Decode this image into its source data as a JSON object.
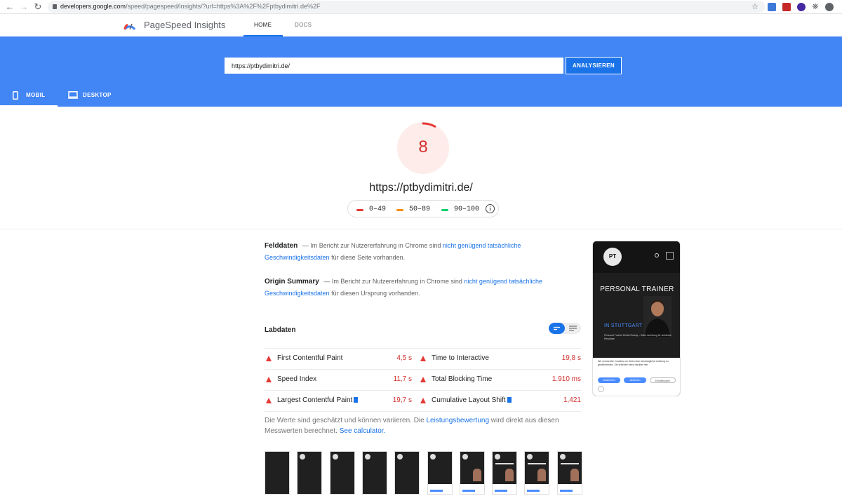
{
  "browser": {
    "url_host": "developers.google.com",
    "url_path": "/speed/pagespeed/insights/?url=https%3A%2F%2Fptbydimitri.de%2F"
  },
  "header": {
    "brand": "PageSpeed Insights",
    "nav": {
      "home": "HOME",
      "docs": "DOCS"
    }
  },
  "search": {
    "value": "https://ptbydimitri.de/",
    "button": "ANALYSIEREN"
  },
  "device_tabs": {
    "mobile": "MOBIL",
    "desktop": "DESKTOP"
  },
  "score": {
    "value": "8",
    "fraction": 0.08,
    "color": "#e53935",
    "url": "https://ptbydimitri.de/",
    "legend": [
      {
        "range": "0–49",
        "color": "#e53935"
      },
      {
        "range": "50–89",
        "color": "#fb8c00"
      },
      {
        "range": "90–100",
        "color": "#0cce6b"
      }
    ]
  },
  "field_data": {
    "title": "Felddaten",
    "text_before": "— Im Bericht zur Nutzererfahrung in Chrome sind",
    "link": "nicht genügend tatsächliche Geschwindigkeitsdaten",
    "text_after": "für diese Seite vorhanden."
  },
  "origin_summary": {
    "title": "Origin Summary",
    "text_before": "— Im Bericht zur Nutzererfahrung in Chrome sind",
    "link": "nicht genügend tatsächliche Geschwindigkeitsdaten",
    "text_after": "für diesen Ursprung vorhanden."
  },
  "lab": {
    "title": "Labdaten",
    "metrics": [
      {
        "name": "First Contentful Paint",
        "value": "4,5 s",
        "flag": false
      },
      {
        "name": "Time to Interactive",
        "value": "19,8 s",
        "flag": false
      },
      {
        "name": "Speed Index",
        "value": "11,7 s",
        "flag": false
      },
      {
        "name": "Total Blocking Time",
        "value": "1.910 ms",
        "flag": false
      },
      {
        "name": "Largest Contentful Paint",
        "value": "19,7 s",
        "flag": true
      },
      {
        "name": "Cumulative Layout Shift",
        "value": "1,421",
        "flag": true
      }
    ],
    "note_before": "Die Werte sind geschätzt und können variieren. Die",
    "note_link": "Leistungsbewertung",
    "note_after": "wird direkt aus diesen Messwerten berechnet.",
    "note_calc": "See calculator."
  },
  "preview": {
    "logo": "PT",
    "headline": "PERSONAL TRAINER",
    "subheadline": "IN STUTTGART",
    "tagline": "Personal Trainer Dimitri Rutsky – Klare Anleitung für sichtbare Resultate",
    "cookie_text": "Wir verwenden Cookies um Ihnen eine bestmögliche Leistung zu gewährleisten. Sie erfahren mehr darüber hier.",
    "cookie_buttons": [
      "Zustimmen",
      "Ablehnen",
      "Einstellungen"
    ]
  },
  "filmstrip": {
    "frames": 10
  }
}
